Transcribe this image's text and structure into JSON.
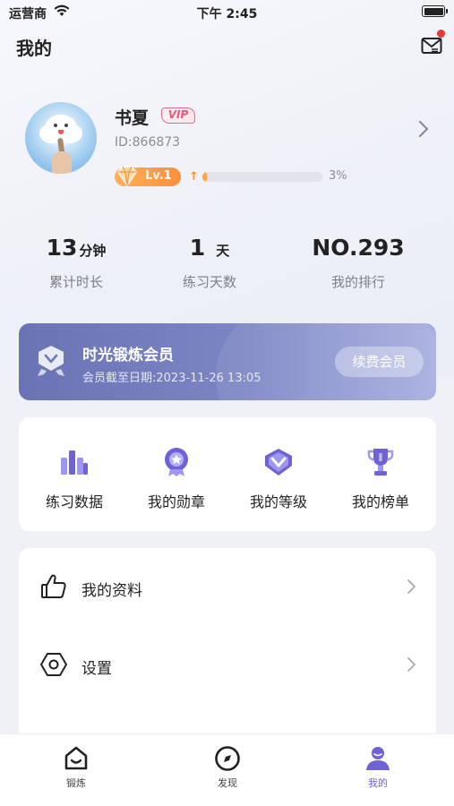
{
  "status_bar": {
    "carrier": "运营商",
    "time": "下午 2:45"
  },
  "header": {
    "title": "我的"
  },
  "profile": {
    "name": "书夏",
    "vip_badge": "VIP",
    "user_id": "ID:866873",
    "level": "Lv.1",
    "progress_text": "3%",
    "progress_fraction": 0.03
  },
  "stats": [
    {
      "value": "13",
      "unit": "分钟",
      "label": "累计时长"
    },
    {
      "value": "1",
      "unit": "天",
      "label": "练习天数"
    },
    {
      "value": "NO.293",
      "unit": "",
      "label": "我的排行"
    }
  ],
  "membership": {
    "title": "时光锻炼会员",
    "expiry": "会员截至日期:2023-11-26 13:05",
    "renew_label": "续费会员"
  },
  "quick_actions": [
    {
      "label": "练习数据",
      "icon": "bar-chart-icon"
    },
    {
      "label": "我的勋章",
      "icon": "medal-icon"
    },
    {
      "label": "我的等级",
      "icon": "diamond-icon"
    },
    {
      "label": "我的榜单",
      "icon": "trophy-icon"
    }
  ],
  "menu": [
    {
      "label": "我的资料",
      "icon": "thumbs-up-icon"
    },
    {
      "label": "设置",
      "icon": "hexagon-nut-icon"
    }
  ],
  "tabs": [
    {
      "label": "锻炼",
      "icon": "home-smile-icon"
    },
    {
      "label": "发现",
      "icon": "compass-icon"
    },
    {
      "label": "我的",
      "icon": "user-icon"
    }
  ],
  "colors": {
    "accent": "#6f62d9",
    "member_card": "#7079bb",
    "level_orange": "#ff9a44",
    "notification_dot": "#e53935"
  }
}
